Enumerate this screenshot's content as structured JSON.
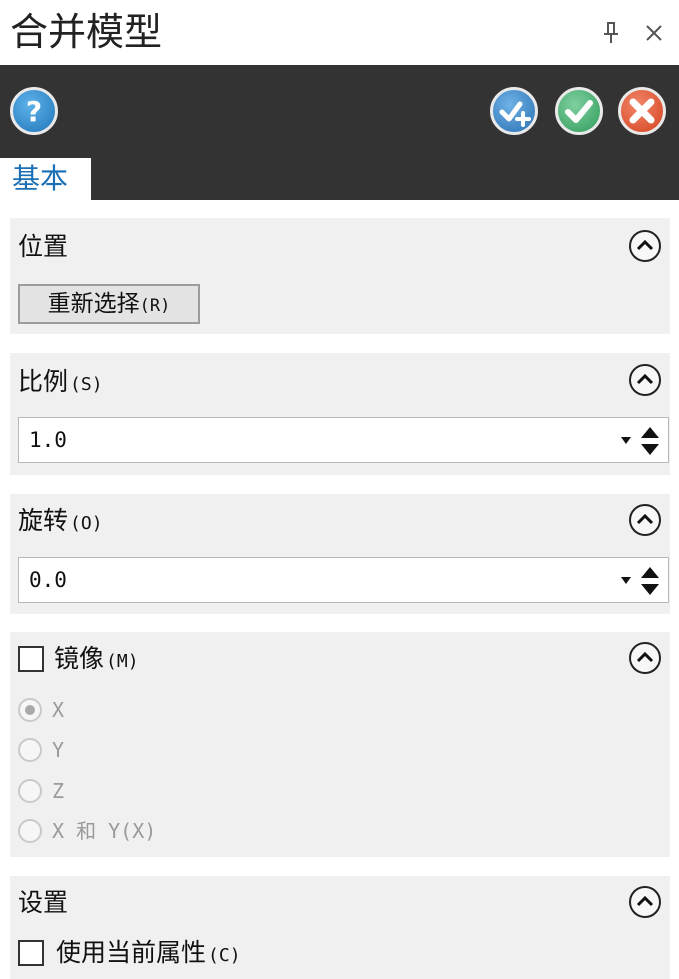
{
  "window": {
    "title": "合并模型"
  },
  "tabs": [
    {
      "label": "基本",
      "active": true
    }
  ],
  "sections": {
    "position": {
      "title": "位置",
      "reselect_label": "重新选择",
      "reselect_key": "(R)"
    },
    "scale": {
      "title": "比例",
      "key": "(S)",
      "value": "1.0"
    },
    "rotation": {
      "title": "旋转",
      "key": "(O)",
      "value": "0.0"
    },
    "mirror": {
      "title": "镜像",
      "key": "(M)",
      "checked": false,
      "options": [
        {
          "label": "X",
          "selected": true
        },
        {
          "label": "Y",
          "selected": false
        },
        {
          "label": "Z",
          "selected": false
        },
        {
          "label": "X 和 Y(X)",
          "selected": false
        }
      ]
    },
    "settings": {
      "title": "设置",
      "use_current_label": "使用当前属性",
      "use_current_key": "(C)",
      "checked": false
    }
  },
  "icons": {
    "pin": "pin-icon",
    "close": "close-icon",
    "help": "help-icon",
    "apply": "apply-icon",
    "ok": "ok-icon",
    "cancel": "cancel-icon",
    "collapse": "chevron-up-icon"
  },
  "colors": {
    "toolbar_bg": "#333333",
    "tab_text": "#1a6fb5",
    "help": "#1f74b8",
    "apply": "#2a6fb4",
    "ok": "#2f9b59",
    "cancel": "#d2421e"
  }
}
